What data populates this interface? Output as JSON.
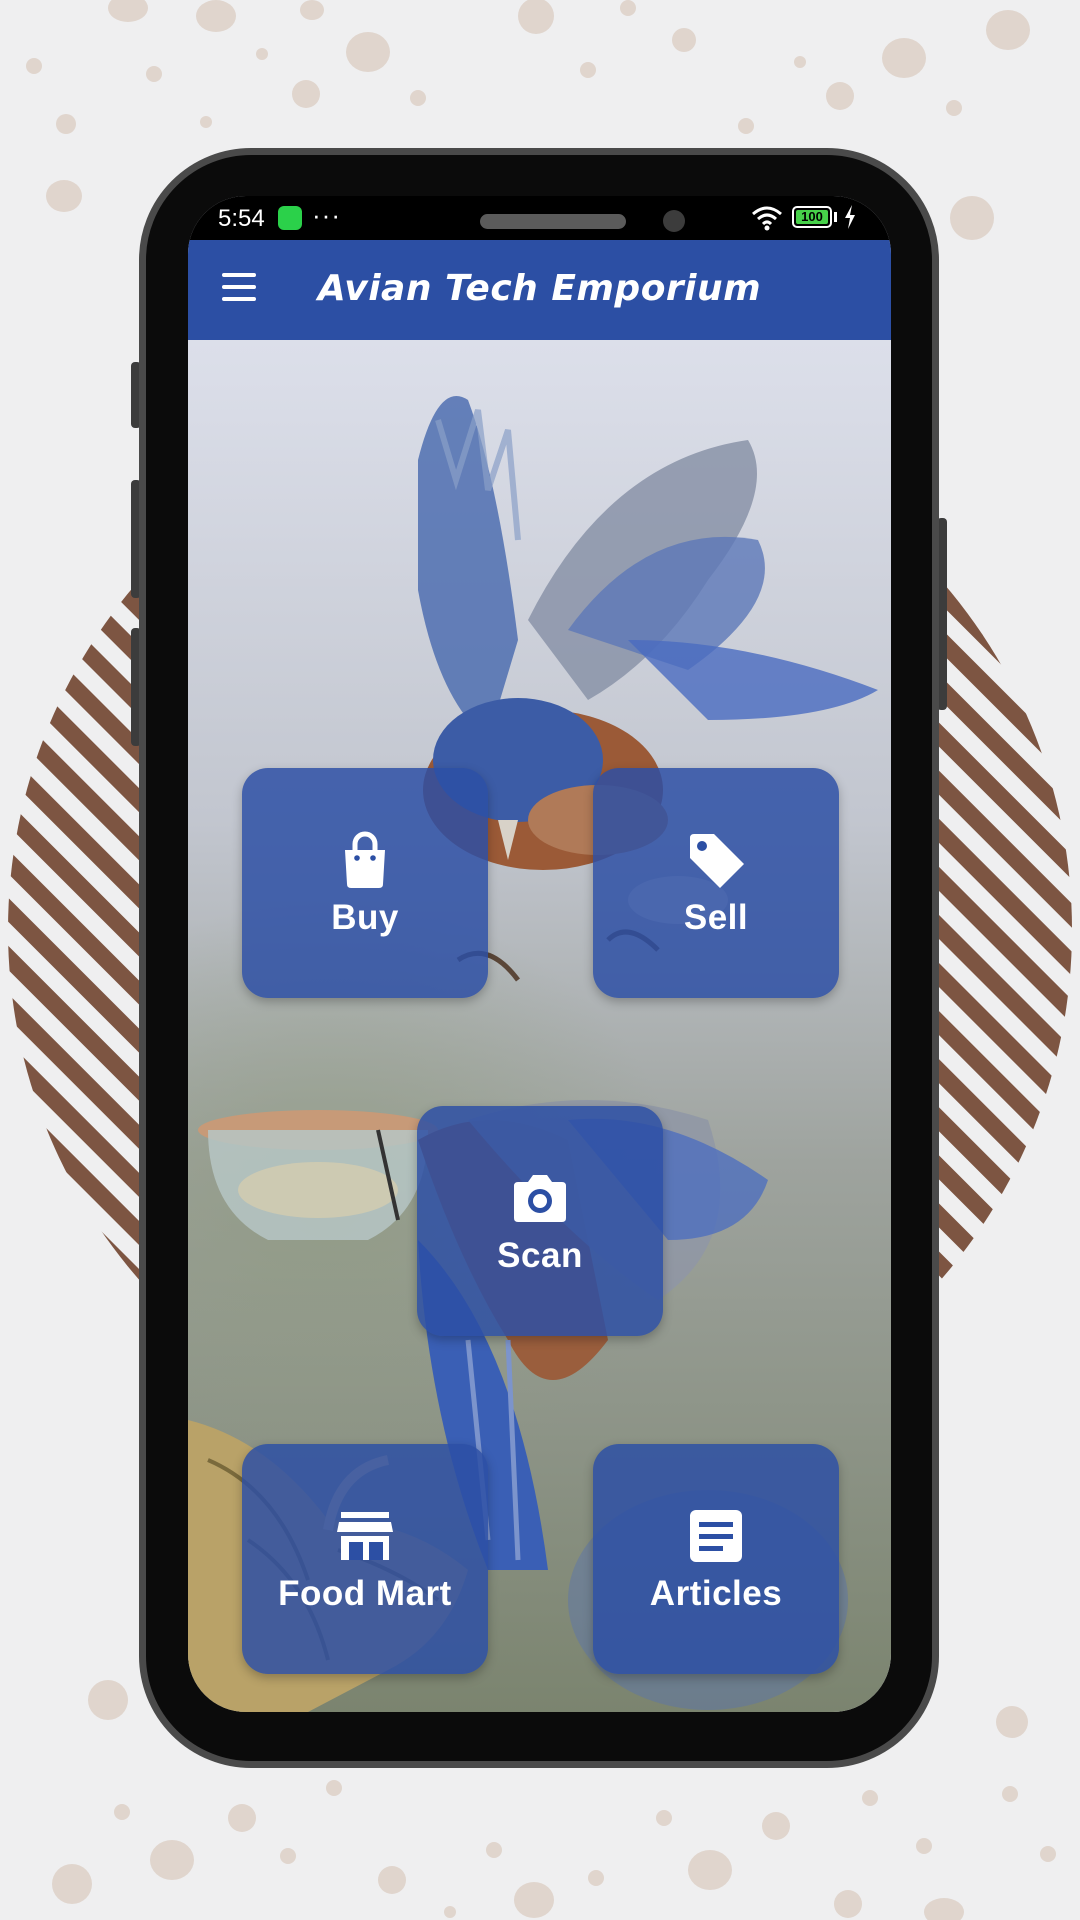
{
  "status_bar": {
    "time": "5:54",
    "more_indicator": "···",
    "battery_level": "100",
    "icons": [
      "app-notification-icon",
      "wifi-icon",
      "battery-icon",
      "charging-icon"
    ]
  },
  "app_bar": {
    "title": "Avian Tech Emporium",
    "menu_icon": "hamburger-menu-icon",
    "color": "#2c4fa4"
  },
  "tiles": [
    {
      "label": "Buy",
      "icon": "shopping-bag-icon"
    },
    {
      "label": "Sell",
      "icon": "price-tag-icon"
    },
    {
      "label": "Scan",
      "icon": "camera-icon"
    },
    {
      "label": "Food Mart",
      "icon": "storefront-icon"
    },
    {
      "label": "Articles",
      "icon": "article-icon"
    }
  ],
  "colors": {
    "accent": "#2c4fa4",
    "tile_bg": "rgba(44,79,164,0.84)",
    "deco_stripes": "#7d5542",
    "deco_dots": "#e0d5cd"
  }
}
